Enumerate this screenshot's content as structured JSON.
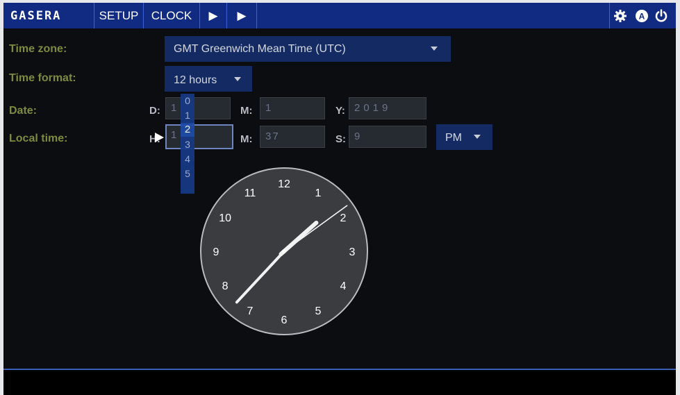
{
  "topbar": {
    "logo": "GASERA",
    "setup": "SETUP",
    "clock": "CLOCK",
    "play1": "▶",
    "play2": "▶",
    "right_icons": [
      "gear-icon",
      "auto-mode-icon",
      "power-icon"
    ],
    "auto_letter": "A"
  },
  "form": {
    "timezone_label": "Time zone:",
    "timezone_value": "GMT Greenwich Mean Time (UTC)",
    "timeformat_label": "Time format:",
    "timeformat_value": "12 hours",
    "date_label": "Date:",
    "localtime_label": "Local time:",
    "day_label": "D:",
    "day_value": "1",
    "month_label": "M:",
    "month_value": "1",
    "year_label": "Y:",
    "year_value": "2019",
    "hour_label": "H:",
    "hour_value": "1",
    "minute_label": "M:",
    "minute_value": "37",
    "second_label": "S:",
    "second_value": "9",
    "ampm_value": "PM"
  },
  "hour_dropdown": {
    "options": [
      "0",
      "1",
      "2",
      "3",
      "4",
      "5"
    ],
    "selected": "2"
  },
  "clock": {
    "numbers": [
      "12",
      "1",
      "2",
      "3",
      "4",
      "5",
      "6",
      "7",
      "8",
      "9",
      "10",
      "11"
    ],
    "hour": 1,
    "minute": 37,
    "second": 9
  },
  "colors": {
    "topbar": "#112a82",
    "label": "#7e8a3e",
    "select_bg": "#142a63"
  }
}
